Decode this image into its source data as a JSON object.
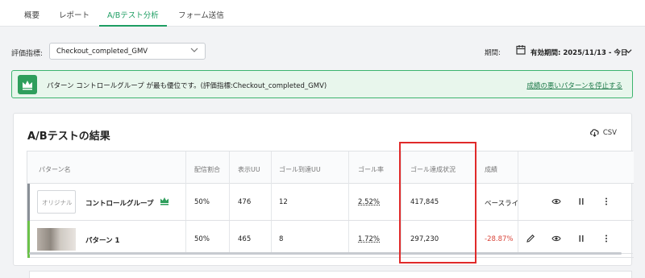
{
  "tabs": [
    {
      "label": "概要"
    },
    {
      "label": "レポート"
    },
    {
      "label": "A/Bテスト分析",
      "active": true
    },
    {
      "label": "フォーム送信"
    }
  ],
  "filter": {
    "label": "評価指標:",
    "selected": "Checkout_completed_GMV",
    "period_label": "期間:",
    "period_value": "有効期間: 2025/11/13 - 今日"
  },
  "banner": {
    "text": "パターン コントロールグループ が最も優位です。(評価指標:Checkout_completed_GMV)",
    "link": "成績の悪いパターンを停止する",
    "color": "#2f9e5c"
  },
  "results": {
    "title": "A/Bテストの結果",
    "csv_label": "CSV",
    "columns": [
      "パターン名",
      "配信割合",
      "表示UU",
      "ゴール到達UU",
      "ゴール率",
      "ゴール達成状況",
      "成績"
    ],
    "rows": [
      {
        "thumb_label": "オリジナル",
        "name": "コントロールグループ",
        "share": "50%",
        "uu": "476",
        "goal_uu": "12",
        "rate": "2.52%",
        "goal_status": "417,845",
        "result": "ベースライ"
      },
      {
        "name": "パターン 1",
        "share": "50%",
        "uu": "465",
        "goal_uu": "8",
        "rate": "1.72%",
        "goal_status": "297,230",
        "result": "-28.87%"
      }
    ]
  },
  "colors": {
    "accent": "#1e9e63",
    "negative": "#d9463b",
    "highlight": "#e02a2a"
  }
}
